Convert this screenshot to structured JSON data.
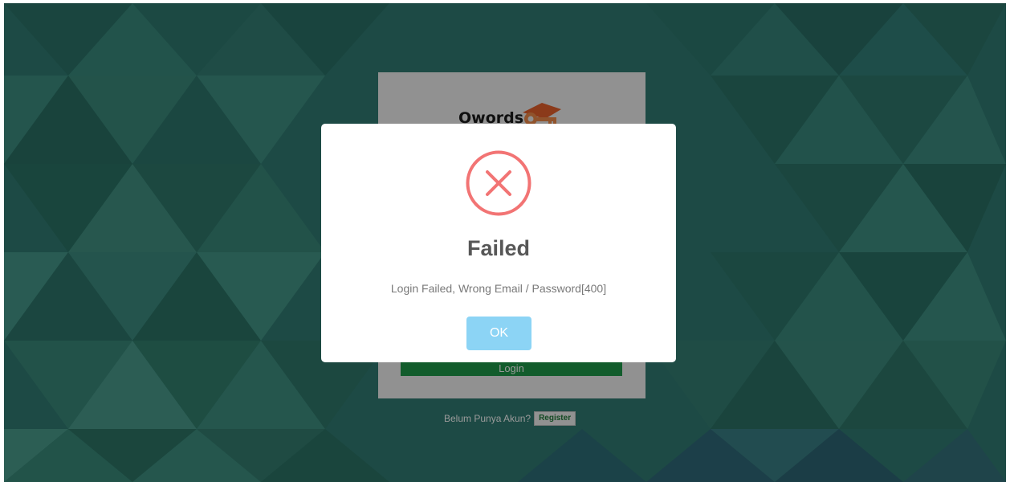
{
  "login": {
    "logo_text": "Owords",
    "login_button": "Login",
    "register_question": "Belum Punya Akun?",
    "register_button": "Register"
  },
  "dialog": {
    "icon": "error-x-icon",
    "title": "Failed",
    "message": "Login Failed, Wrong Email / Password[400]",
    "ok_button": "OK"
  },
  "colors": {
    "background": "#2f7a72",
    "login_button": "#1f9a4a",
    "error_icon": "#f27474",
    "ok_button": "#8cd4f5",
    "logo_key": "#e8622c"
  }
}
